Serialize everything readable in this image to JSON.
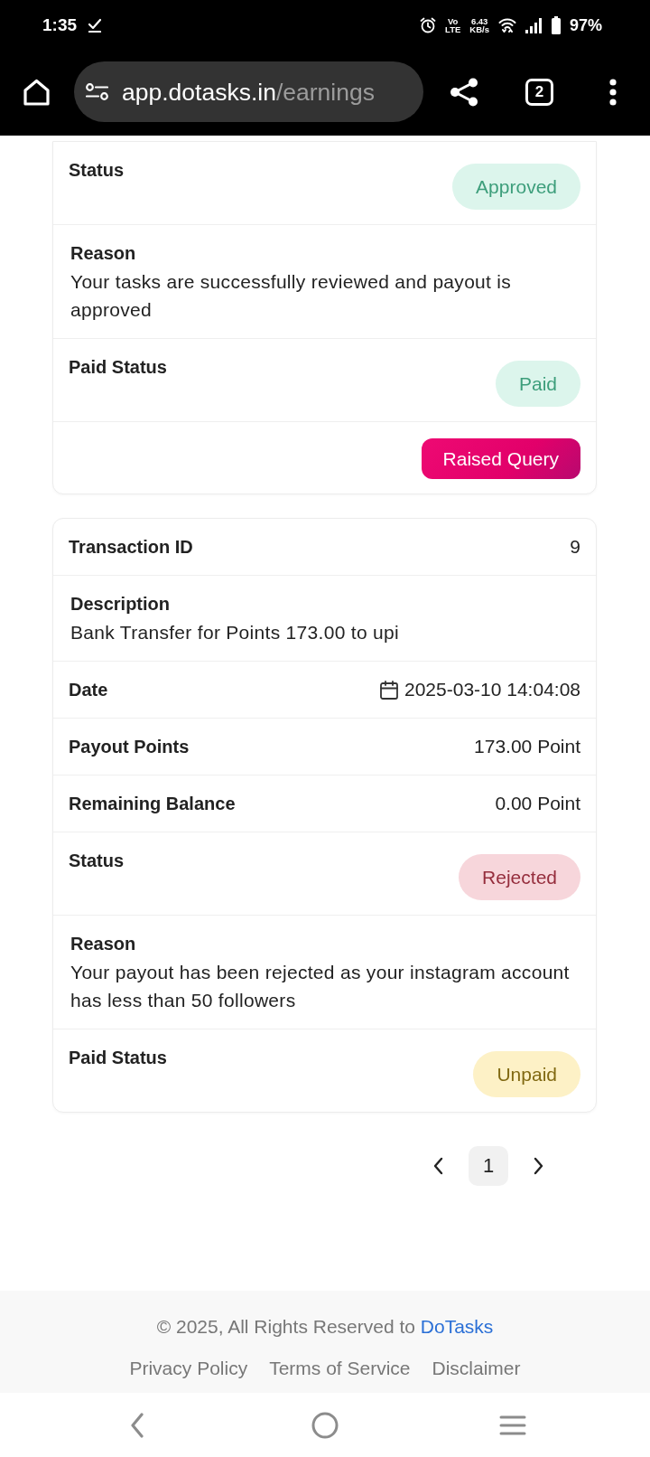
{
  "status_bar": {
    "time": "1:35",
    "volte": [
      "Vo",
      "LTE"
    ],
    "speed": [
      "6.43",
      "KB/s"
    ],
    "battery": "97%"
  },
  "browser": {
    "url": {
      "host": "app.dotasks.in",
      "path": "/earnings"
    },
    "tab_count": "2"
  },
  "transactions": [
    {
      "rows": [
        {
          "kind": "badge",
          "label": "Status",
          "value": "Approved",
          "color": "#dcf5ec"
        },
        {
          "kind": "paragraph",
          "label": "Reason",
          "text": "Your tasks are successfully reviewed and payout is approved"
        },
        {
          "kind": "badge",
          "label": "Paid Status",
          "value": "Paid",
          "color": "#dcf5ec"
        },
        {
          "kind": "action",
          "button": "Raised Query"
        }
      ]
    },
    {
      "rows": [
        {
          "kind": "field",
          "label": "Transaction ID",
          "value": "9"
        },
        {
          "kind": "paragraph",
          "label": "Description",
          "text": "Bank Transfer for Points 173.00 to upi"
        },
        {
          "kind": "date",
          "label": "Date",
          "value": "2025-03-10 14:04:08"
        },
        {
          "kind": "field",
          "label": "Payout Points",
          "value": "173.00 Point"
        },
        {
          "kind": "field",
          "label": "Remaining Balance",
          "value": "0.00 Point"
        },
        {
          "kind": "badge",
          "label": "Status",
          "value": "Rejected",
          "color": "#f7d6db"
        },
        {
          "kind": "paragraph",
          "label": "Reason",
          "text": "Your payout has been rejected as your instagram account has less than 50 followers"
        },
        {
          "kind": "badge",
          "label": "Paid Status",
          "value": "Unpaid",
          "color": "#fdf1c6"
        }
      ]
    }
  ],
  "pagination": {
    "pages": [
      {
        "label": "1",
        "selected": true
      }
    ]
  },
  "footer": {
    "copyright": "© 2025, All Rights Reserved to",
    "brand_link": "DoTasks",
    "links": [
      "Privacy Policy",
      "Terms of Service",
      "Disclaimer"
    ]
  }
}
